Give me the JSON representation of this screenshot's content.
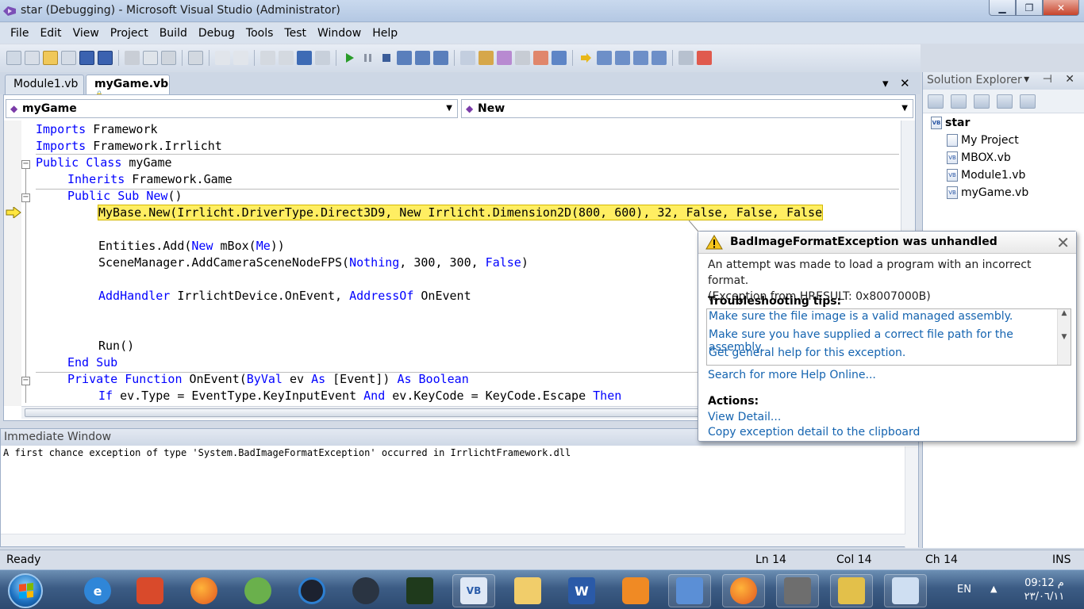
{
  "window": {
    "title": "star (Debugging) - Microsoft Visual Studio (Administrator)",
    "min_label": "▁",
    "max_label": "❐",
    "close_label": "✕"
  },
  "menu": [
    "File",
    "Edit",
    "View",
    "Project",
    "Build",
    "Debug",
    "Tools",
    "Test",
    "Window",
    "Help"
  ],
  "doc_tabs": [
    {
      "label": "Module1.vb",
      "active": false
    },
    {
      "label": "myGame.vb",
      "active": true
    }
  ],
  "tab_controls": {
    "dropdown": "▾",
    "close": "✕"
  },
  "editor": {
    "class_combo": "myGame",
    "method_combo": "New",
    "code": [
      [
        "Imports",
        " Framework"
      ],
      [
        "Imports",
        " Framework.Irrlicht"
      ],
      [
        "Public Class",
        " myGame"
      ],
      [
        "Inherits",
        " Framework.Game"
      ],
      [
        "Public Sub New",
        "()"
      ],
      [
        "MyBase.New(Irrlicht.DriverType.Direct3D9, New Irrlicht.Dimension2D(800, 600), 32, False, False, False"
      ],
      [
        "Entities.Add(",
        "New",
        " mBox(",
        "Me",
        "))"
      ],
      [
        "SceneManager.AddCameraSceneNodeFPS(",
        "Nothing",
        ", 300, 300, ",
        "False",
        ")"
      ],
      [
        "AddHandler",
        " IrrlichtDevice.OnEvent, ",
        "AddressOf",
        " OnEvent"
      ],
      [
        "Run()"
      ],
      [
        "End Sub"
      ],
      [
        "Private Function",
        " OnEvent(",
        "ByVal",
        " ev ",
        "As",
        " [Event]) ",
        "As Boolean"
      ],
      [
        "If",
        " ev.Type = EventType.KeyInputEvent ",
        "And",
        " ev.KeyCode = KeyCode.Escape ",
        "Then"
      ]
    ]
  },
  "immediate": {
    "title": "Immediate Window",
    "output": "A first chance exception of type 'System.BadImageFormatException' occurred in IrrlichtFramework.dll"
  },
  "exception": {
    "title": "BadImageFormatException was unhandled",
    "message_line1": "An attempt was made to load a program with an incorrect format.",
    "message_line2": "(Exception from HRESULT: 0x8007000B)",
    "tips_heading": "Troubleshooting tips:",
    "tips": [
      "Make sure the file image is a valid managed assembly.",
      "Make sure you have supplied a correct file path for the assembly.",
      "Get general help for this exception."
    ],
    "search_link": "Search for more Help Online...",
    "actions_heading": "Actions:",
    "actions": [
      "View Detail...",
      "Copy exception detail to the clipboard"
    ]
  },
  "solution_explorer": {
    "title": "Solution Explorer",
    "controls": "▾ ⊣ ✕",
    "root": "star",
    "items": [
      "My Project",
      "MBOX.vb",
      "Module1.vb",
      "myGame.vb"
    ]
  },
  "status": {
    "text": "Ready",
    "ln": "Ln 14",
    "col": "Col 14",
    "ch": "Ch 14",
    "ins": "INS"
  },
  "taskbar": {
    "lang": "EN",
    "tray_arrow": "▲",
    "time": "09:12 م",
    "date": "٢٣/٠٦/١١"
  },
  "colors": {
    "keyword": "#0000ff",
    "current_line": "#ffee62",
    "link": "#1564b0"
  }
}
